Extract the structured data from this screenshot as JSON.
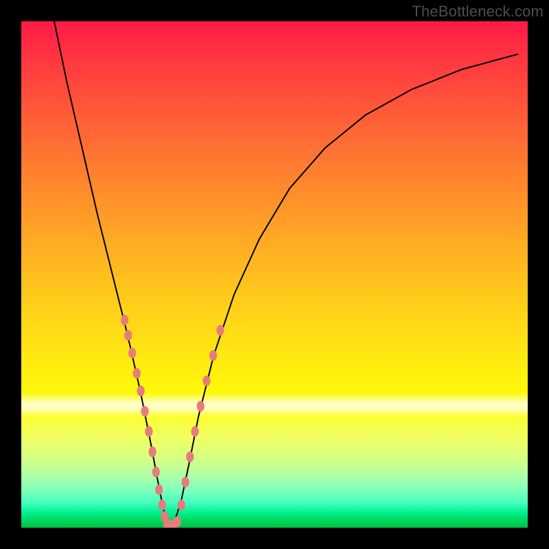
{
  "watermark": {
    "text": "TheBottleneck.com"
  },
  "chart_data": {
    "type": "line",
    "title": "",
    "xlabel": "",
    "ylabel": "",
    "xlim": [
      0,
      100
    ],
    "ylim": [
      0,
      100
    ],
    "gradient_stops": [
      {
        "pos": 0,
        "color": "#ff1a46"
      },
      {
        "pos": 18,
        "color": "#ff5a38"
      },
      {
        "pos": 38,
        "color": "#ff9a28"
      },
      {
        "pos": 58,
        "color": "#ffd418"
      },
      {
        "pos": 73,
        "color": "#fff80a"
      },
      {
        "pos": 86,
        "color": "#d8ff80"
      },
      {
        "pos": 95,
        "color": "#48ffc0"
      },
      {
        "pos": 100,
        "color": "#00c040"
      }
    ],
    "series": [
      {
        "name": "bottleneck-curve",
        "x": [
          6.5,
          9,
          12,
          15,
          18,
          21,
          23.5,
          25.5,
          27,
          28,
          28.8,
          30,
          31.5,
          33,
          35,
          38,
          42,
          47,
          53,
          60,
          68,
          77,
          87,
          98
        ],
        "y": [
          100,
          88,
          75,
          62,
          50,
          38,
          27,
          17,
          9,
          4,
          0.5,
          0.5,
          5,
          12,
          22,
          34,
          46,
          57,
          67,
          75,
          81.5,
          86.5,
          90.5,
          93.5
        ]
      }
    ],
    "overlay_dots": {
      "left_branch": [
        [
          20.4,
          41
        ],
        [
          21.1,
          38
        ],
        [
          21.9,
          34.5
        ],
        [
          22.8,
          30.5
        ],
        [
          23.6,
          27
        ],
        [
          24.4,
          23
        ],
        [
          25.2,
          19
        ],
        [
          25.9,
          15
        ],
        [
          26.6,
          11
        ],
        [
          27.2,
          7.5
        ],
        [
          27.8,
          4.5
        ],
        [
          28.3,
          2.2
        ]
      ],
      "bottom": [
        [
          28.8,
          0.6
        ],
        [
          29.4,
          0.5
        ],
        [
          30.1,
          0.6
        ],
        [
          30.8,
          1.2
        ]
      ],
      "right_branch": [
        [
          31.6,
          4.5
        ],
        [
          32.4,
          9
        ],
        [
          33.3,
          14
        ],
        [
          34.3,
          19
        ],
        [
          35.4,
          24
        ],
        [
          36.6,
          29
        ],
        [
          37.9,
          34
        ],
        [
          39.3,
          39
        ]
      ]
    },
    "dot_style": {
      "fill": "#e77c7c",
      "rx": 5.6,
      "ry": 7.8
    }
  }
}
